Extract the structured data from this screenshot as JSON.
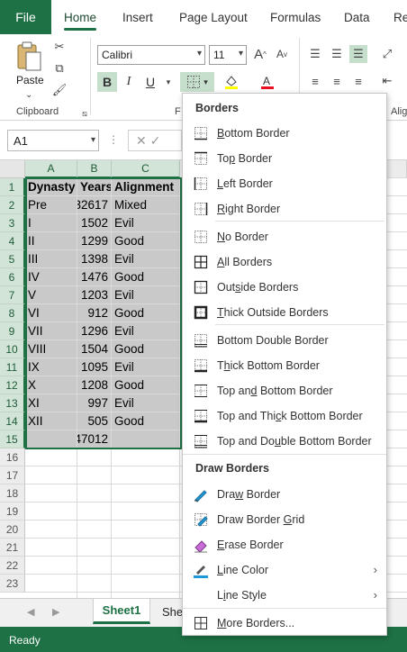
{
  "ribbon": {
    "tabs": [
      "File",
      "Home",
      "Insert",
      "Page Layout",
      "Formulas",
      "Data",
      "Re"
    ],
    "active_tab": "Home",
    "clipboard_label": "Clipboard",
    "font_group_label": "F",
    "alignment_label": "Alig",
    "paste_label": "Paste",
    "font_name": "Calibri",
    "font_size": "11",
    "bold": "B",
    "italic": "I",
    "underline": "U"
  },
  "formula_bar": {
    "name_box": "A1"
  },
  "grid": {
    "columns": [
      "A",
      "B",
      "C"
    ],
    "header": [
      "Dynasty",
      "Years",
      "Alignment"
    ],
    "rows": [
      [
        "Pre",
        "32617",
        "Mixed"
      ],
      [
        "I",
        "1502",
        "Evil"
      ],
      [
        "II",
        "1299",
        "Good"
      ],
      [
        "III",
        "1398",
        "Evil"
      ],
      [
        "IV",
        "1476",
        "Good"
      ],
      [
        "V",
        "1203",
        "Evil"
      ],
      [
        "VI",
        "912",
        "Good"
      ],
      [
        "VII",
        "1296",
        "Evil"
      ],
      [
        "VIII",
        "1504",
        "Good"
      ],
      [
        "IX",
        "1095",
        "Evil"
      ],
      [
        "X",
        "1208",
        "Good"
      ],
      [
        "XI",
        "997",
        "Evil"
      ],
      [
        "XII",
        "505",
        "Good"
      ],
      [
        "",
        "47012",
        ""
      ]
    ],
    "row_numbers": [
      "1",
      "2",
      "3",
      "4",
      "5",
      "6",
      "7",
      "8",
      "9",
      "10",
      "11",
      "12",
      "13",
      "14",
      "15",
      "16",
      "17",
      "18",
      "19",
      "20",
      "21",
      "22",
      "23"
    ]
  },
  "sheets": {
    "active": "Sheet1",
    "next": "She"
  },
  "status": "Ready",
  "menu": {
    "header_borders": "Borders",
    "header_draw": "Draw Borders",
    "items": [
      {
        "pre": "",
        "acc": "B",
        "post": "ottom Border"
      },
      {
        "pre": "To",
        "acc": "p",
        "post": " Border"
      },
      {
        "pre": "",
        "acc": "L",
        "post": "eft Border"
      },
      {
        "pre": "",
        "acc": "R",
        "post": "ight Border"
      },
      {
        "pre": "",
        "acc": "N",
        "post": "o Border"
      },
      {
        "pre": "",
        "acc": "A",
        "post": "ll Borders"
      },
      {
        "pre": "Out",
        "acc": "s",
        "post": "ide Borders"
      },
      {
        "pre": "",
        "acc": "T",
        "post": "hick Outside Borders"
      },
      {
        "pre": "Bottom Double Border",
        "acc": "",
        "post": ""
      },
      {
        "pre": "T",
        "acc": "h",
        "post": "ick Bottom Border"
      },
      {
        "pre": "Top an",
        "acc": "d",
        "post": " Bottom Border"
      },
      {
        "pre": "Top and Thi",
        "acc": "c",
        "post": "k Bottom Border"
      },
      {
        "pre": "Top and Do",
        "acc": "u",
        "post": "ble Bottom Border"
      }
    ],
    "draw_items": [
      {
        "pre": "Dra",
        "acc": "w",
        "post": " Border"
      },
      {
        "pre": "Draw Border ",
        "acc": "G",
        "post": "rid"
      },
      {
        "pre": "",
        "acc": "E",
        "post": "rase Border"
      },
      {
        "pre": "",
        "acc": "L",
        "post": "ine Color"
      },
      {
        "pre": "L",
        "acc": "i",
        "post": "ne Style"
      },
      {
        "pre": "",
        "acc": "M",
        "post": "ore Borders..."
      }
    ]
  },
  "colors": {
    "accent": "#1e7145",
    "selection": "#c9c9c9",
    "line_color": "#1e9bd7",
    "highlight_color": "#ffff00",
    "font_color": "#e81123"
  }
}
